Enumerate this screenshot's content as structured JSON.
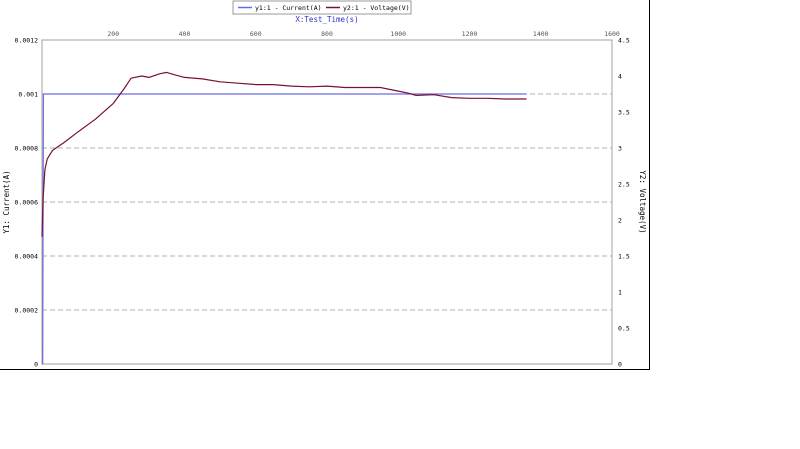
{
  "chart_data": {
    "type": "line",
    "title": "X:Test_Time(s)",
    "xlabel": "X:Test_Time(s)",
    "xlim": [
      0,
      1600
    ],
    "x_ticks": [
      "200",
      "400",
      "600",
      "800",
      "1000",
      "1200",
      "1400",
      "1600"
    ],
    "y1": {
      "label": "Y1: Current(A)",
      "ylim": [
        0,
        0.0012
      ],
      "ticks": [
        "0",
        "0.0002",
        "0.0004",
        "0.0006",
        "0.0008",
        "0.001",
        "0.0012"
      ]
    },
    "y2": {
      "label": "Y2: Voltage(V)",
      "ylim": [
        0,
        4.5
      ],
      "ticks": [
        "0",
        "0.5",
        "1",
        "1.5",
        "2",
        "2.5",
        "3",
        "3.5",
        "4",
        "4.5"
      ]
    },
    "grid": "horizontal dashed at y2 ticks 0.75 V spacing",
    "legend": "top-center",
    "series": [
      {
        "name": "y1:1 - Current(A)",
        "axis": "y1",
        "color": "#6a6ae6",
        "x": [
          0,
          2,
          4,
          6,
          1360
        ],
        "y": [
          0,
          0,
          0.001,
          0.001,
          0.001
        ]
      },
      {
        "name": "y2:1 - Voltage(V)",
        "axis": "y2",
        "color": "#7a1030",
        "x": [
          0,
          3,
          8,
          15,
          30,
          60,
          100,
          150,
          200,
          230,
          250,
          280,
          300,
          330,
          350,
          370,
          400,
          450,
          500,
          550,
          600,
          650,
          700,
          750,
          800,
          850,
          900,
          950,
          1000,
          1030,
          1050,
          1100,
          1150,
          1200,
          1250,
          1300,
          1360
        ],
        "y": [
          1.77,
          2.3,
          2.7,
          2.85,
          2.97,
          3.07,
          3.22,
          3.4,
          3.62,
          3.82,
          3.97,
          4.0,
          3.98,
          4.03,
          4.05,
          4.02,
          3.98,
          3.96,
          3.92,
          3.9,
          3.88,
          3.88,
          3.86,
          3.85,
          3.86,
          3.84,
          3.84,
          3.84,
          3.79,
          3.76,
          3.73,
          3.74,
          3.7,
          3.69,
          3.69,
          3.68,
          3.68
        ]
      }
    ]
  }
}
